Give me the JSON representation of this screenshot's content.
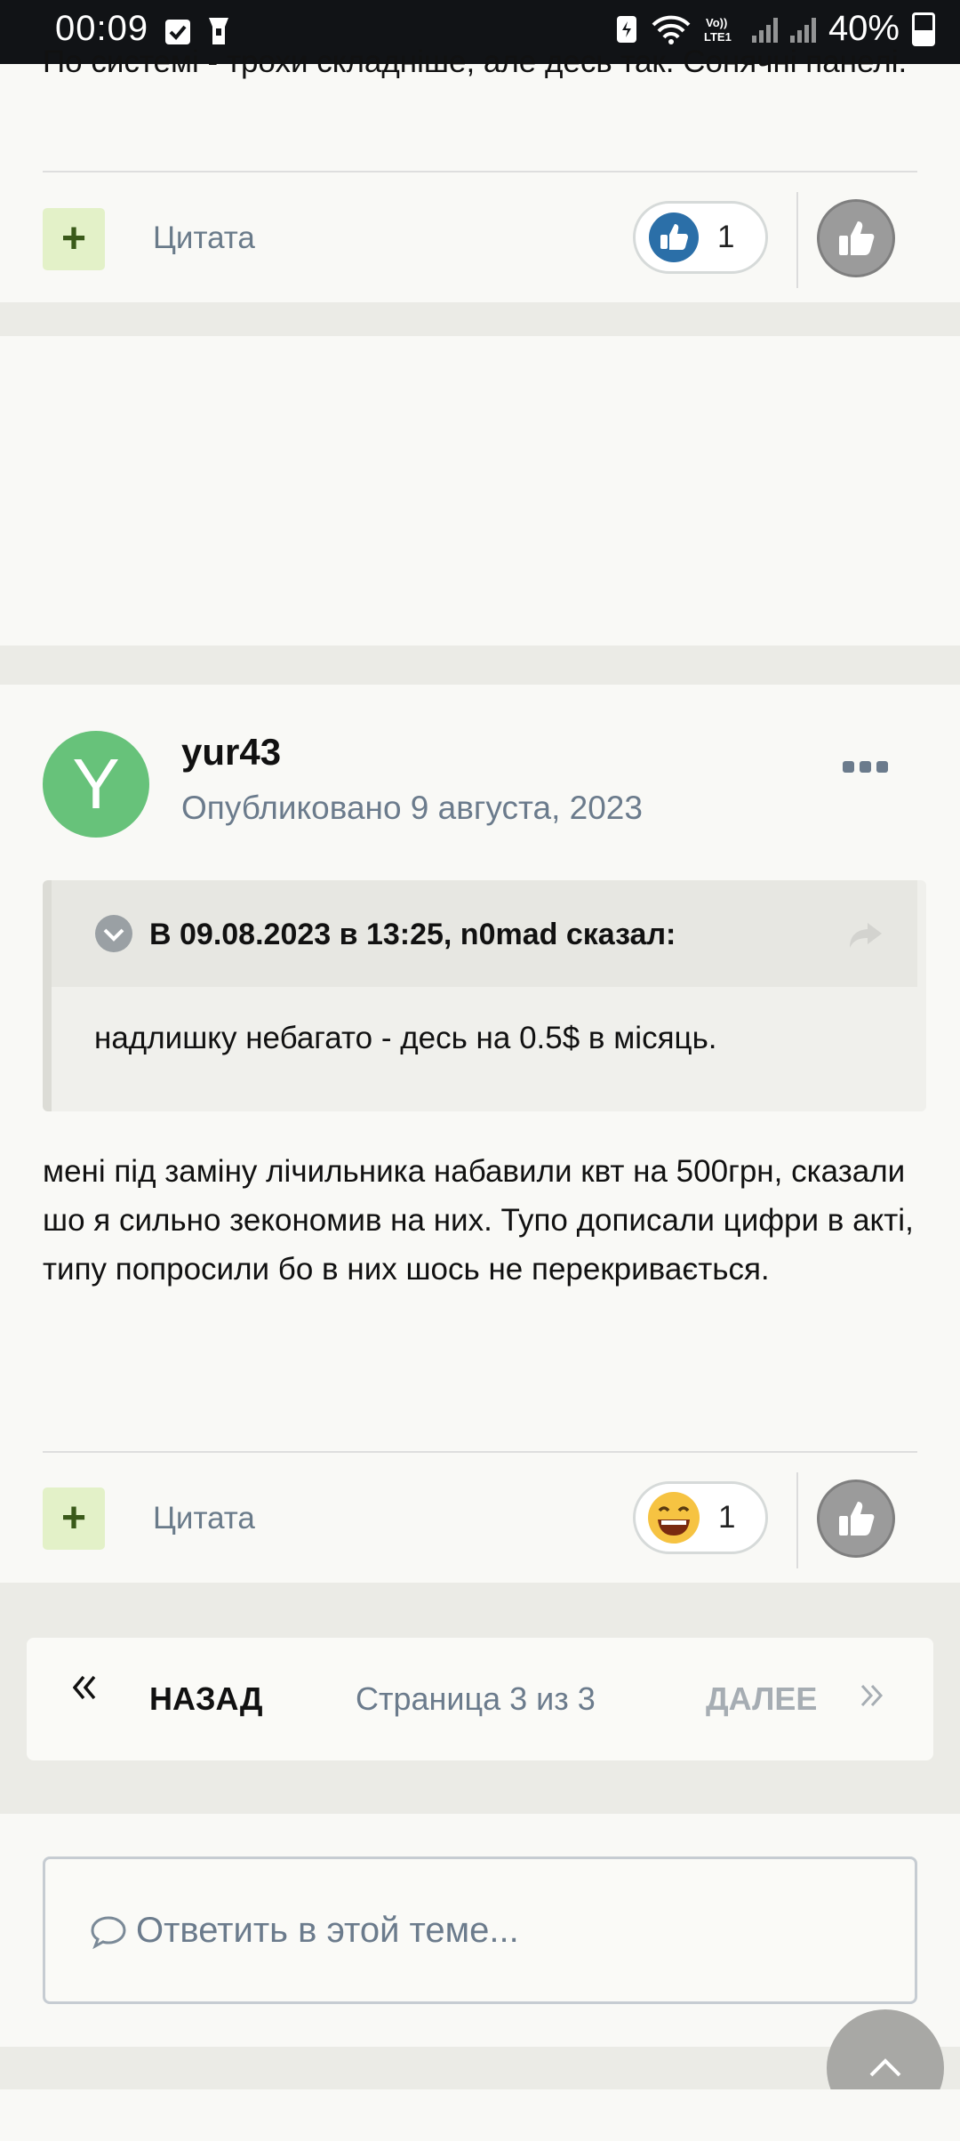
{
  "status_bar": {
    "time": "00:09",
    "battery": "40%"
  },
  "post_prev": {
    "text_tail": "По системі - трохи складніше, але десь так. Сонячні панелі.",
    "quote_label": "Цитата",
    "reaction_icon": "thumbs-up-blue-icon",
    "reaction_count": "1"
  },
  "post": {
    "avatar_letter": "Y",
    "avatar_color": "#67c27a",
    "author": "yur43",
    "published": "Опубликовано 9 августа, 2023",
    "quote": {
      "header": "В 09.08.2023 в 13:25, n0mad сказал:",
      "body": "надлишку небагато - десь на 0.5$ в місяць."
    },
    "body": "мені під заміну лічильника набавили квт на 500грн, сказали шо я сильно зекономив на них. Тупо дописали цифри в акті, типу попросили бо в них шось не перекривається.",
    "quote_label": "Цитата",
    "reaction_icon": "laughing-face-icon",
    "reaction_count": "1"
  },
  "pagination": {
    "prev_label": "НАЗАД",
    "page_info": "Страница 3 из 3",
    "next_label": "ДАЛЕЕ"
  },
  "reply": {
    "placeholder": "Ответить в этой теме..."
  },
  "colors": {
    "accent_green": "#e3f1c8",
    "link_gray": "#6b7b8c",
    "like_blue": "#2b6fa8"
  }
}
